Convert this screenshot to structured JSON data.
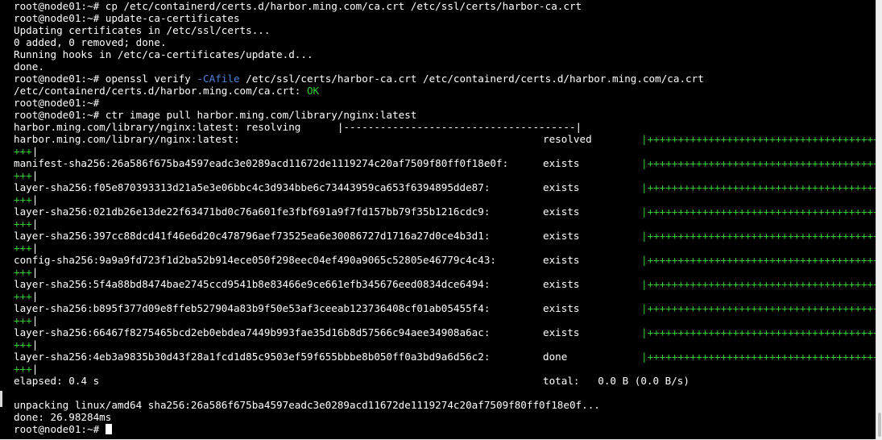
{
  "terminal": {
    "cmd_cp": "root@node01:~# cp /etc/containerd/certs.d/harbor.ming.com/ca.crt /etc/ssl/certs/harbor-ca.crt",
    "cmd_update": "root@node01:~# update-ca-certificates",
    "updating": "Updating certificates in /etc/ssl/certs...",
    "added": "0 added, 0 removed; done.",
    "hooks": "Running hooks in /etc/ca-certificates/update.d...",
    "done": "done.",
    "openssl_prefix": "root@node01:~# openssl verify ",
    "openssl_flag": "-CAfile",
    "openssl_rest": " /etc/ssl/certs/harbor-ca.crt /etc/containerd/certs.d/harbor.ming.com/ca.crt",
    "verify_path": "/etc/containerd/certs.d/harbor.ming.com/ca.crt: ",
    "verify_ok": "OK",
    "prompt_empty": "root@node01:~#",
    "cmd_pull": "root@node01:~# ctr image pull harbor.ming.com/library/nginx:latest",
    "resolving_text": "harbor.ming.com/library/nginx:latest: resolving      |--------------------------------------|",
    "bar_full": "|++++++++++++++++++++++++++++++++++++++",
    "bar_tail": "+++",
    "bar_pipe": "|",
    "layers": [
      {
        "name": "harbor.ming.com/library/nginx:latest:",
        "status": "resolved"
      },
      {
        "name": "manifest-sha256:26a586f675ba4597eadc3e0289acd11672de1119274c20af7509f80ff0f18e0f:",
        "status": "exists"
      },
      {
        "name": "layer-sha256:f05e870393313d21a5e3e06bbc4c3d934bbe6c73443959ca653f6394895dde87:",
        "status": "exists"
      },
      {
        "name": "layer-sha256:021db26e13de22f63471bd0c76a601fe3fbf691a9f7fd157bb79f35b1216cdc9:",
        "status": "exists"
      },
      {
        "name": "layer-sha256:397cc88dcd41f46e6d20c478796aef73525ea6e30086727d1716a27d0ce4b3d1:",
        "status": "exists"
      },
      {
        "name": "config-sha256:9a9a9fd723f1d2ba52b914ece050f298eec04ef490a9065c52805e46779c4c43:",
        "status": "exists"
      },
      {
        "name": "layer-sha256:5f4a88bd8474bae2745ccd9541b8e83466e9ce661efb345676eed0834dce6494:",
        "status": "exists"
      },
      {
        "name": "layer-sha256:b895f377d09e8ffeb527904a83b9f50e53af3ceeab123736408cf01ab05455f4:",
        "status": "exists"
      },
      {
        "name": "layer-sha256:66467f8275465bcd2eb0ebdea7449b993fae35d16b8d57566c94aee34908a6ac:",
        "status": "exists"
      },
      {
        "name": "layer-sha256:4eb3a9835b30d43f28a1fcd1d85c9503ef59f655bbbe8b050ff0a3bd9a6d56c2:",
        "status": "done"
      }
    ],
    "elapsed": "elapsed: 0.4 s",
    "total": "total:   0.0 B (0.0 B/s)",
    "unpacking": "unpacking linux/amd64 sha256:26a586f675ba4597eadc3e0289acd11672de1119274c20af7509f80ff0f18e0f...",
    "done_time": "done: 26.98284ms",
    "final_prompt": "root@node01:~# "
  },
  "colors": {
    "background": "#000000",
    "text": "#ffffff",
    "green": "#33cc33",
    "blue": "#4f83d8"
  }
}
